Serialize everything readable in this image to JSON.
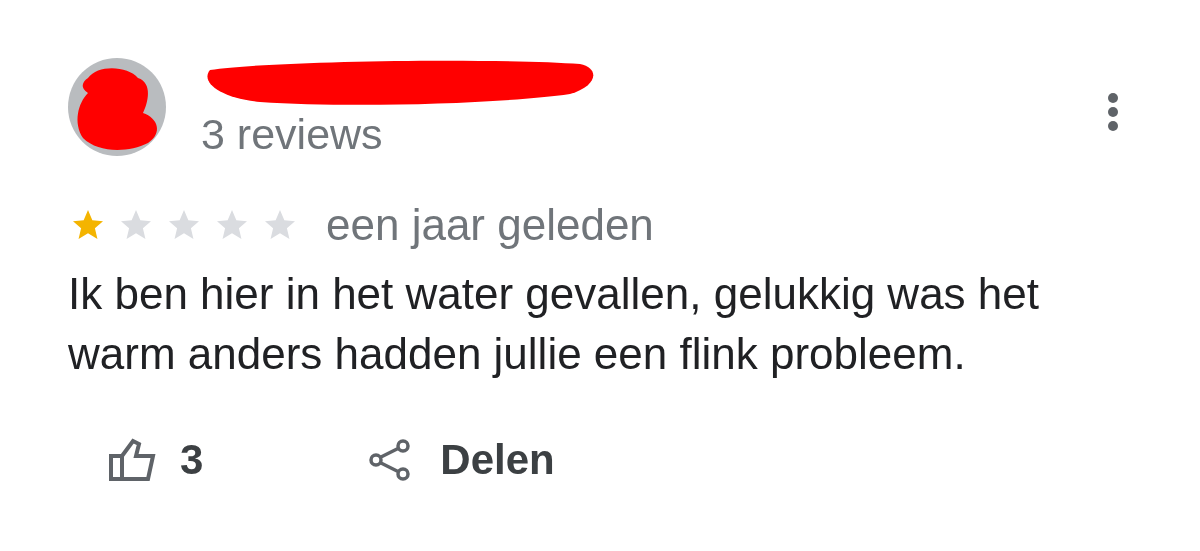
{
  "review": {
    "reviewer_name_redacted": true,
    "reviews_count": "3 reviews",
    "stars": 1,
    "date": "een jaar geleden",
    "text": "Ik ben hier in het water gevallen, gelukkig was het warm anders hadden jullie een flink probleem.",
    "likes": "3",
    "share_label": "Delen"
  }
}
